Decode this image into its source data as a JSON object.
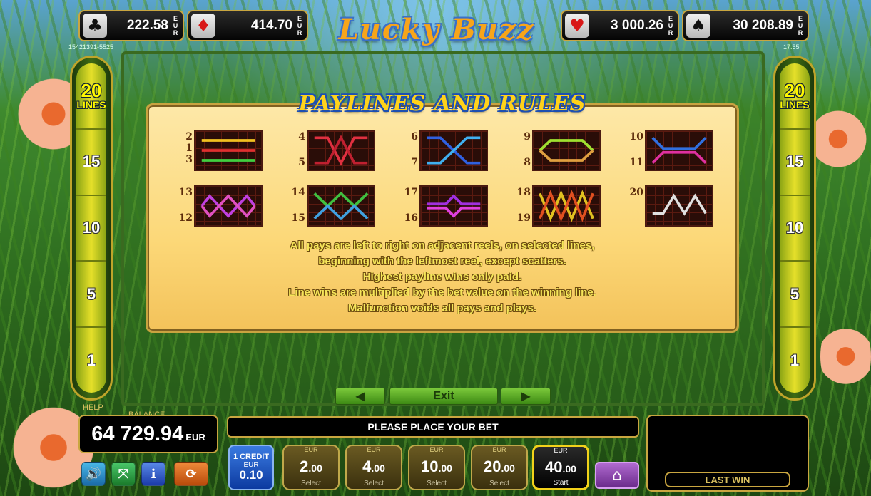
{
  "jackpots": [
    {
      "icon": "club-icon",
      "glyph": "♣",
      "value": "222.58",
      "currency": "EUR"
    },
    {
      "icon": "diamond-icon",
      "glyph": "♦",
      "value": "414.70",
      "currency": "EUR"
    },
    {
      "icon": "heart-icon",
      "glyph": "♥",
      "value": "3 000.26",
      "currency": "EUR"
    },
    {
      "icon": "spade-icon",
      "glyph": "♠",
      "value": "30 208.89",
      "currency": "EUR"
    }
  ],
  "session_id": "15421391-5525",
  "clock": "17:55",
  "logo": "Lucky Buzz",
  "lines_meter": {
    "top_value": "20",
    "top_label": "LINES",
    "levels": [
      "15",
      "10",
      "5",
      "1"
    ]
  },
  "paytable": {
    "title": "PAYLINES AND RULES",
    "line_numbers": {
      "g1": [
        "2",
        "1",
        "3"
      ],
      "g2": [
        "4",
        "5"
      ],
      "g3": [
        "6",
        "7"
      ],
      "g4": [
        "9",
        "8"
      ],
      "g5": [
        "10",
        "11"
      ],
      "g6": [
        "13",
        "12"
      ],
      "g7": [
        "14",
        "15"
      ],
      "g8": [
        "17",
        "16"
      ],
      "g9": [
        "18",
        "19"
      ],
      "g10": [
        "20"
      ]
    },
    "rules": [
      "All pays are left to right on adjacent reels, on selected lines,",
      "beginning with the leftmost reel, except scatters.",
      "Highest payline wins only paid.",
      "Line wins are multiplied by the bet value on the winning line.",
      "Malfunction voids all pays and plays."
    ]
  },
  "nav": {
    "prev": "◀",
    "exit": "Exit",
    "next": "▶"
  },
  "help_label": "HELP",
  "balance": {
    "label": "BALANCE",
    "value": "64 729.94",
    "currency": "EUR"
  },
  "message": "PLEASE PLACE YOUR BET",
  "credit": {
    "line1": "1 CREDIT",
    "currency": "EUR",
    "value": "0.10"
  },
  "bets": [
    {
      "currency": "EUR",
      "int": "2",
      "dec": ".00",
      "action": "Select"
    },
    {
      "currency": "EUR",
      "int": "4",
      "dec": ".00",
      "action": "Select"
    },
    {
      "currency": "EUR",
      "int": "10",
      "dec": ".00",
      "action": "Select"
    },
    {
      "currency": "EUR",
      "int": "20",
      "dec": ".00",
      "action": "Select"
    },
    {
      "currency": "EUR",
      "int": "40",
      "dec": ".00",
      "action": "Start"
    }
  ],
  "last_win_label": "LAST WIN",
  "colors": {
    "gold": "#c9a640",
    "panel": "#fcd878",
    "active_bet": "#f2d21a",
    "credit_blue": "#0c3aa0"
  }
}
